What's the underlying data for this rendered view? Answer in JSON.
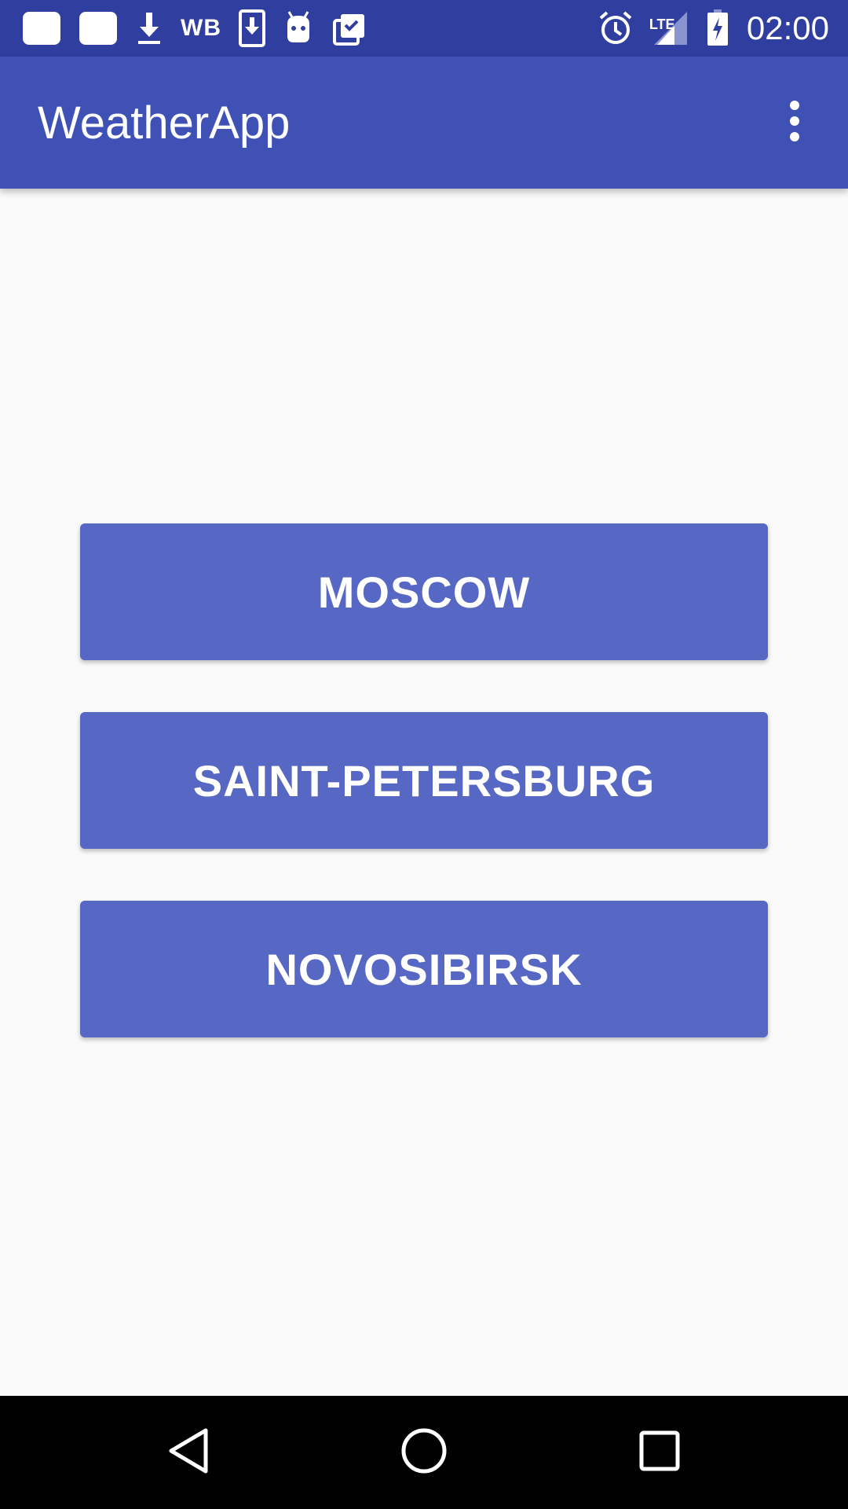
{
  "status_bar": {
    "wb_label": "WB",
    "lte_label": "LTE",
    "time": "02:00",
    "icons": [
      "notification-square-icon",
      "notification-square-icon",
      "download-icon",
      "wb-text",
      "phone-download-icon",
      "android-icon",
      "clipboard-check-icon",
      "alarm-icon",
      "signal-icon",
      "battery-charging-icon"
    ]
  },
  "app_bar": {
    "title": "WeatherApp",
    "overflow_icon": "more-vert-icon"
  },
  "cities": [
    {
      "label": "MOSCOW"
    },
    {
      "label": "SAINT-PETERSBURG"
    },
    {
      "label": "NOVOSIBIRSK"
    }
  ],
  "nav_bar": {
    "icons": [
      "back-icon",
      "home-icon",
      "recents-icon"
    ]
  },
  "colors": {
    "status_bar": "#303f9f",
    "app_bar": "#3f51b5",
    "button": "#5767c4",
    "background": "#fafafa",
    "nav_bar": "#000000"
  }
}
